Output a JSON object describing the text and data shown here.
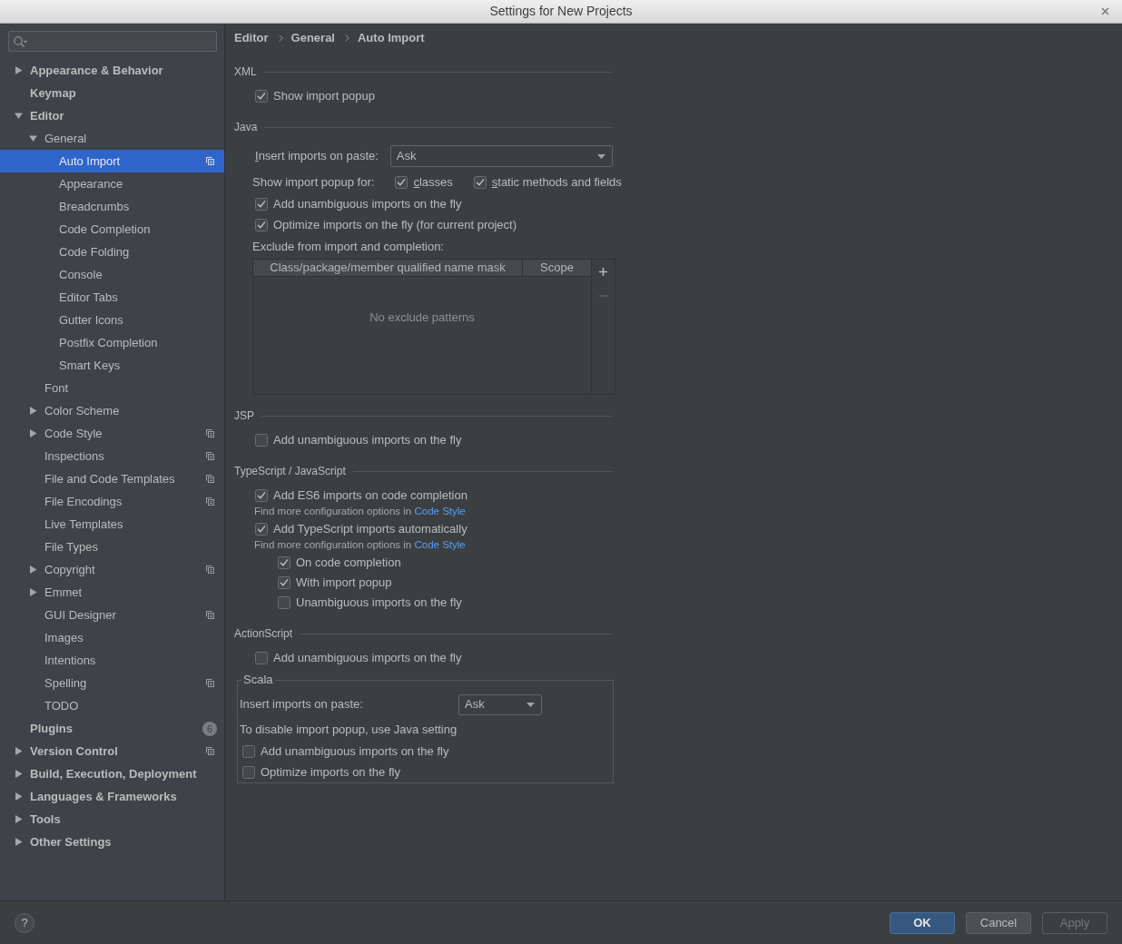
{
  "window": {
    "title": "Settings for New Projects"
  },
  "sidebar": {
    "items": [
      {
        "label": "Appearance & Behavior",
        "expanded": false,
        "selected": false,
        "shared": false
      },
      {
        "label": "Keymap",
        "selected": false,
        "shared": false
      },
      {
        "label": "Editor",
        "expanded": true,
        "selected": false,
        "shared": false,
        "children": [
          {
            "label": "General",
            "expanded": true,
            "selected": false,
            "shared": false,
            "children": [
              {
                "label": "Auto Import",
                "selected": true,
                "shared": true
              },
              {
                "label": "Appearance",
                "selected": false,
                "shared": false
              },
              {
                "label": "Breadcrumbs",
                "selected": false,
                "shared": false
              },
              {
                "label": "Code Completion",
                "selected": false,
                "shared": false
              },
              {
                "label": "Code Folding",
                "selected": false,
                "shared": false
              },
              {
                "label": "Console",
                "selected": false,
                "shared": false
              },
              {
                "label": "Editor Tabs",
                "selected": false,
                "shared": false
              },
              {
                "label": "Gutter Icons",
                "selected": false,
                "shared": false
              },
              {
                "label": "Postfix Completion",
                "selected": false,
                "shared": false
              },
              {
                "label": "Smart Keys",
                "selected": false,
                "shared": false
              }
            ]
          },
          {
            "label": "Font",
            "selected": false,
            "shared": false
          },
          {
            "label": "Color Scheme",
            "expanded": false,
            "selected": false,
            "shared": false
          },
          {
            "label": "Code Style",
            "expanded": false,
            "selected": false,
            "shared": true
          },
          {
            "label": "Inspections",
            "selected": false,
            "shared": true
          },
          {
            "label": "File and Code Templates",
            "selected": false,
            "shared": true
          },
          {
            "label": "File Encodings",
            "selected": false,
            "shared": true
          },
          {
            "label": "Live Templates",
            "selected": false,
            "shared": false
          },
          {
            "label": "File Types",
            "selected": false,
            "shared": false
          },
          {
            "label": "Copyright",
            "expanded": false,
            "selected": false,
            "shared": true
          },
          {
            "label": "Emmet",
            "expanded": false,
            "selected": false,
            "shared": false
          },
          {
            "label": "GUI Designer",
            "selected": false,
            "shared": true
          },
          {
            "label": "Images",
            "selected": false,
            "shared": false
          },
          {
            "label": "Intentions",
            "selected": false,
            "shared": false
          },
          {
            "label": "Spelling",
            "selected": false,
            "shared": true
          },
          {
            "label": "TODO",
            "selected": false,
            "shared": false
          }
        ]
      },
      {
        "label": "Plugins",
        "selected": false,
        "shared": false,
        "badge": "6"
      },
      {
        "label": "Version Control",
        "expanded": false,
        "selected": false,
        "shared": true
      },
      {
        "label": "Build, Execution, Deployment",
        "expanded": false,
        "selected": false,
        "shared": false
      },
      {
        "label": "Languages & Frameworks",
        "expanded": false,
        "selected": false,
        "shared": false
      },
      {
        "label": "Tools",
        "expanded": false,
        "selected": false,
        "shared": false
      },
      {
        "label": "Other Settings",
        "expanded": false,
        "selected": false,
        "shared": false
      }
    ]
  },
  "breadcrumb": [
    "Editor",
    "General",
    "Auto Import"
  ],
  "sections": [
    {
      "kind": "group",
      "title": "XML",
      "rows": [
        {
          "kind": "checkbox",
          "label": "Show import popup",
          "checked": true
        }
      ]
    },
    {
      "kind": "group",
      "title": "Java",
      "rows": [
        {
          "kind": "select",
          "label": "Insert imports on paste:",
          "mnemonic": true,
          "value": "Ask"
        },
        {
          "kind": "checkbox_line",
          "label": "Show import popup for:",
          "options": [
            {
              "label": "classes",
              "mnemonic": true,
              "checked": true
            },
            {
              "label": "static methods and fields",
              "mnemonic": true,
              "checked": true
            }
          ]
        },
        {
          "kind": "checkbox",
          "label": "Add unambiguous imports on the fly",
          "checked": true
        },
        {
          "kind": "checkbox",
          "label": "Optimize imports on the fly (for current project)",
          "checked": true
        },
        {
          "kind": "label",
          "text": "Exclude from import and completion:"
        },
        {
          "kind": "table",
          "columns": [
            "Class/package/member qualified name mask",
            "Scope"
          ],
          "empty_text": "No exclude patterns",
          "toolbar": [
            {
              "kind": "add",
              "disabled": false
            },
            {
              "kind": "remove",
              "disabled": true
            }
          ]
        }
      ]
    },
    {
      "kind": "group",
      "title": "JSP",
      "rows": [
        {
          "kind": "checkbox",
          "label": "Add unambiguous imports on the fly",
          "checked": false
        }
      ]
    },
    {
      "kind": "group",
      "title": "TypeScript / JavaScript",
      "rows": [
        {
          "kind": "checkbox",
          "label": "Add ES6 imports on code completion",
          "checked": true,
          "hint": {
            "text": "Find more configuration options in",
            "link": "Code Style"
          }
        },
        {
          "kind": "checkbox",
          "label": "Add TypeScript imports automatically",
          "checked": true,
          "hint": {
            "text": "Find more configuration options in",
            "link": "Code Style"
          },
          "children": [
            {
              "kind": "checkbox",
              "label": "On code completion",
              "checked": true
            },
            {
              "kind": "checkbox",
              "label": "With import popup",
              "checked": true
            },
            {
              "kind": "checkbox",
              "label": "Unambiguous imports on the fly",
              "checked": false
            }
          ]
        }
      ]
    },
    {
      "kind": "group",
      "title": "ActionScript",
      "rows": [
        {
          "kind": "checkbox",
          "label": "Add unambiguous imports on the fly",
          "checked": false
        }
      ]
    },
    {
      "kind": "panel",
      "title": "Scala",
      "rows": [
        {
          "kind": "select",
          "label": "Insert imports on paste:",
          "mnemonic": false,
          "value": "Ask"
        },
        {
          "kind": "label",
          "text": "To disable import popup, use Java setting"
        },
        {
          "kind": "checkbox",
          "label": "Add unambiguous imports on the fly",
          "checked": false
        },
        {
          "kind": "checkbox",
          "label": "Optimize imports on the fly",
          "checked": false
        }
      ]
    }
  ],
  "footer": {
    "help": "?",
    "buttons": [
      {
        "label": "OK",
        "kind": "primary",
        "disabled": false
      },
      {
        "label": "Cancel",
        "kind": "default",
        "disabled": false
      },
      {
        "label": "Apply",
        "kind": "default",
        "disabled": true
      }
    ]
  }
}
